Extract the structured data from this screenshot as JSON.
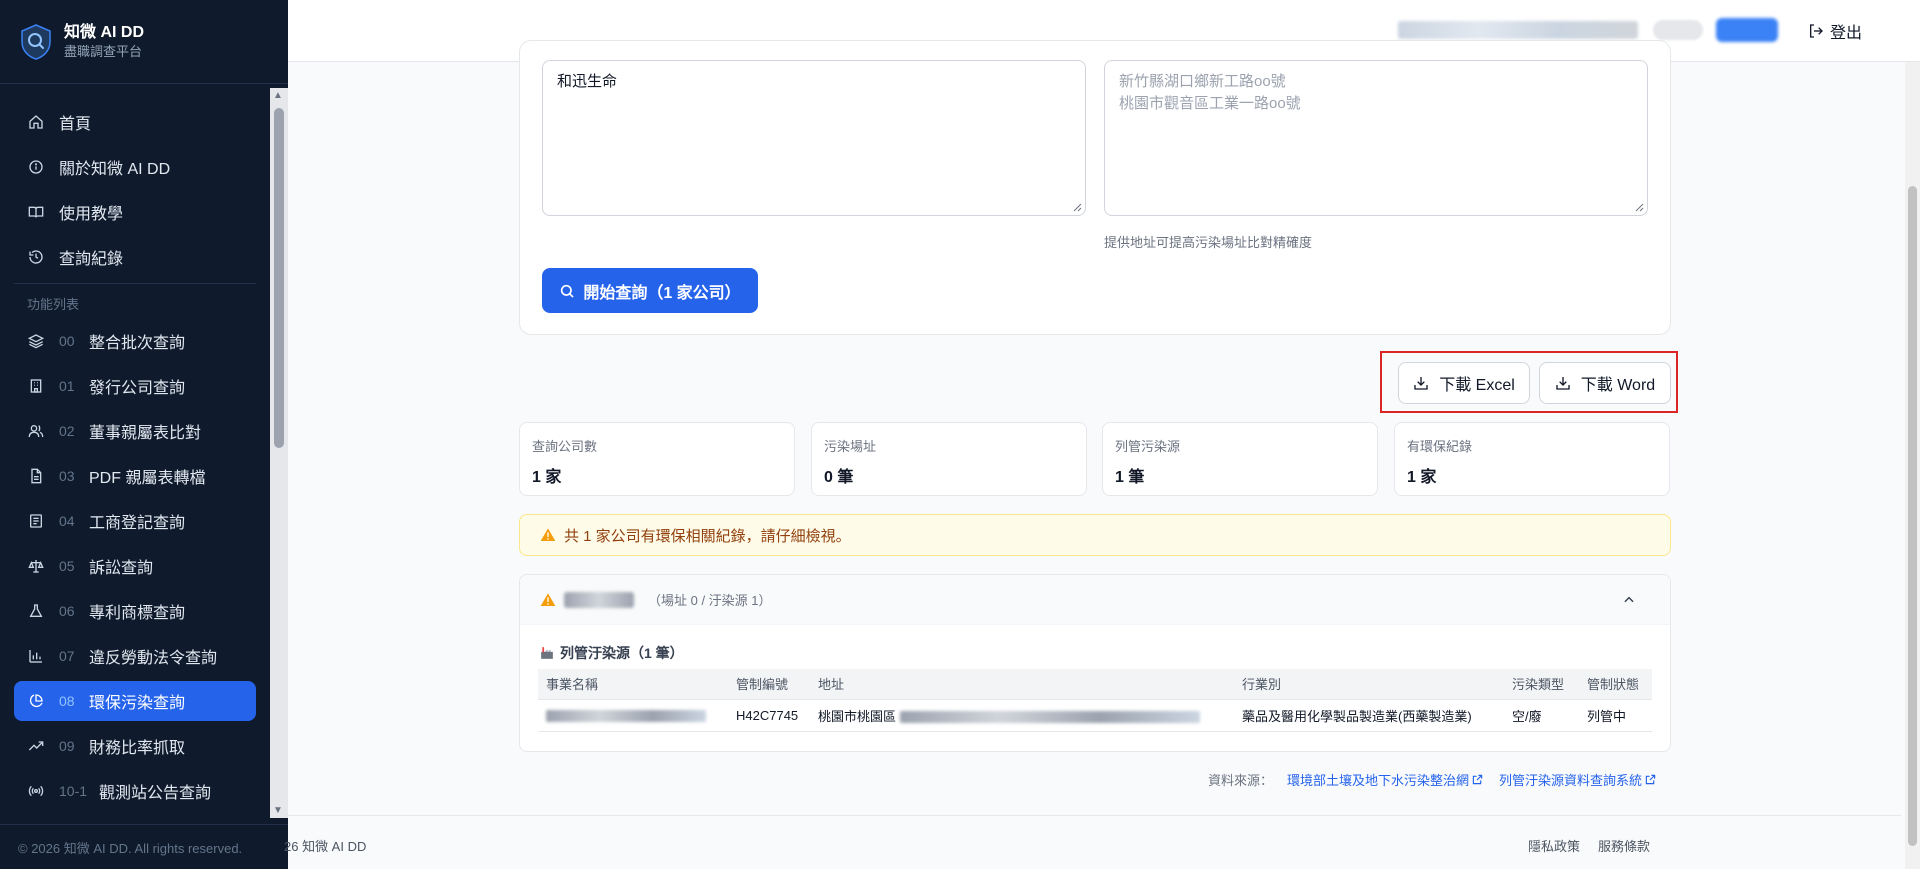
{
  "brand": {
    "title": "知微 AI DD",
    "subtitle": "盡職調查平台"
  },
  "nav": {
    "main": [
      {
        "label": "首頁",
        "icon": "home-icon"
      },
      {
        "label": "關於知微 AI DD",
        "icon": "info-icon"
      },
      {
        "label": "使用教學",
        "icon": "book-icon"
      },
      {
        "label": "查詢紀錄",
        "icon": "history-icon"
      }
    ],
    "section_label": "功能列表",
    "features": [
      {
        "num": "00",
        "label": "整合批次查詢",
        "icon": "layers-icon"
      },
      {
        "num": "01",
        "label": "發行公司查詢",
        "icon": "building-icon"
      },
      {
        "num": "02",
        "label": "董事親屬表比對",
        "icon": "users-icon"
      },
      {
        "num": "03",
        "label": "PDF 親屬表轉檔",
        "icon": "file-icon"
      },
      {
        "num": "04",
        "label": "工商登記查詢",
        "icon": "register-icon"
      },
      {
        "num": "05",
        "label": "訴訟查詢",
        "icon": "scale-icon"
      },
      {
        "num": "06",
        "label": "專利商標查詢",
        "icon": "flask-icon"
      },
      {
        "num": "07",
        "label": "違反勞動法令查詢",
        "icon": "bar-chart-icon"
      },
      {
        "num": "08",
        "label": "環保污染查詢",
        "icon": "pie-chart-icon",
        "active": true
      },
      {
        "num": "09",
        "label": "財務比率抓取",
        "icon": "trending-up-icon"
      },
      {
        "num": "10-1",
        "label": "觀測站公告查詢",
        "icon": "broadcast-icon"
      }
    ],
    "footer": "© 2026 知微 AI DD. All rights reserved."
  },
  "header": {
    "logout": "登出"
  },
  "form": {
    "companies_value": "和迅生命",
    "address_placeholder_line1": "新竹縣湖口鄉新工路oo號",
    "address_placeholder_line2": "桃園市觀音區工業一路oo號",
    "address_hint": "提供地址可提高污染場址比對精確度",
    "submit": "開始查詢（1 家公司）"
  },
  "downloads": {
    "excel": "下載 Excel",
    "word": "下載 Word"
  },
  "stats": [
    {
      "label": "查詢公司數",
      "value": "1 家"
    },
    {
      "label": "污染場址",
      "value": "0 筆"
    },
    {
      "label": "列管污染源",
      "value": "1 筆"
    },
    {
      "label": "有環保紀錄",
      "value": "1 家"
    }
  ],
  "alert": "共 1 家公司有環保相關紀錄，請仔細檢視。",
  "result": {
    "counts": "（場址 0 / 汙染源 1）",
    "section_title": "列管汙染源（1 筆）",
    "columns": [
      "事業名稱",
      "管制編號",
      "地址",
      "行業別",
      "污染類型",
      "管制狀態"
    ],
    "row": {
      "control_no": "H42C7745",
      "address_prefix": "桃園市桃園區",
      "industry": "藥品及醫用化學製品製造業(西藥製造業)",
      "pollution_type": "空/廢",
      "status": "列管中"
    }
  },
  "sources": {
    "label": "資料來源：",
    "link1": "環境部土壤及地下水污染整治網",
    "link2": "列管汙染源資料查詢系統"
  },
  "footer": {
    "copyright": "26 知微 AI DD",
    "privacy": "隱私政策",
    "terms": "服務條款"
  },
  "colors": {
    "primary": "#2563eb",
    "sidebar": "#0f1b2d",
    "highlight": "#dc2626",
    "warning": "#d97706"
  }
}
